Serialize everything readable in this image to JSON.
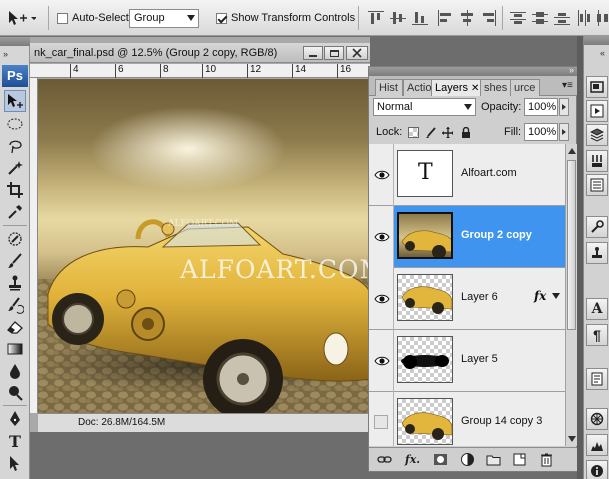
{
  "options_bar": {
    "auto_select_label": "Auto-Select:",
    "auto_select_checked": false,
    "auto_select_value": "Group",
    "show_transform_label": "Show Transform Controls",
    "show_transform_checked": true
  },
  "tools": {
    "logo": "Ps"
  },
  "document": {
    "title": "nk_car_final.psd @ 12.5% (Group 2 copy, RGB/8)",
    "ruler_ticks": [
      "4",
      "6",
      "8",
      "10",
      "12",
      "14",
      "16"
    ],
    "watermark_large": "ALFOART.COM",
    "watermark_small": "ALFOART.COM",
    "status": "Doc: 26.8M/164.5M"
  },
  "layers_panel": {
    "tabs": [
      {
        "label": "Hist"
      },
      {
        "label": "Actio"
      },
      {
        "label": "Layers"
      },
      {
        "label": "shes"
      },
      {
        "label": "urce"
      }
    ],
    "blend_mode": "Normal",
    "opacity_label": "Opacity:",
    "opacity_value": "100%",
    "lock_label": "Lock:",
    "fill_label": "Fill:",
    "fill_value": "100%",
    "layers": [
      {
        "name": "Alfoart.com",
        "type": "text",
        "visible": true,
        "selected": false,
        "thumb_text": "T"
      },
      {
        "name": "Group 2 copy",
        "type": "image",
        "visible": true,
        "selected": true
      },
      {
        "name": "Layer 6",
        "type": "image",
        "visible": true,
        "selected": false,
        "fx": "fx"
      },
      {
        "name": "Layer 5",
        "type": "shadow",
        "visible": true,
        "selected": false
      },
      {
        "name": "Group 14 copy 3",
        "type": "image",
        "visible": false,
        "selected": false
      }
    ]
  },
  "colors": {
    "selection_blue": "#3e94ee",
    "ps_logo_blue": "#2a62b0",
    "gold": "#e2b53c"
  }
}
